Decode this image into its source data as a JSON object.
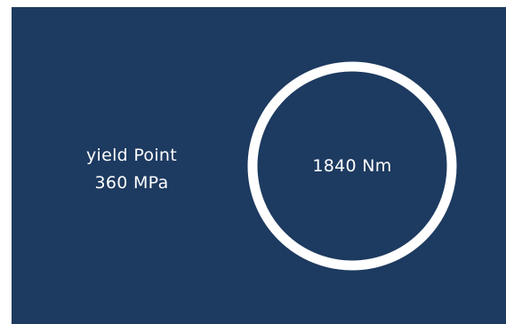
{
  "panel": {
    "background_color": "#1d3a60",
    "label": "yield Point",
    "value": "360 MPa"
  },
  "gauge": {
    "value": "1840 Nm",
    "ring_color": "#ffffff"
  }
}
